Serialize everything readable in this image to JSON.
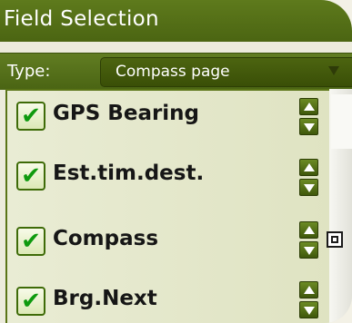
{
  "window": {
    "title": "Field Selection"
  },
  "type": {
    "label": "Type:",
    "selected": "Compass page"
  },
  "fields": [
    {
      "label": "GPS Bearing",
      "checked": true,
      "check_glyph": "✔"
    },
    {
      "label": "Est.tim.dest.",
      "checked": true,
      "check_glyph": "✔"
    },
    {
      "label": "Compass",
      "checked": true,
      "check_glyph": "✔"
    },
    {
      "label": "Brg.Next",
      "checked": true,
      "check_glyph": "✔"
    }
  ],
  "icons": {
    "move_up": "triangle-up-icon",
    "move_down": "triangle-down-icon",
    "field_selected": "square-target-icon"
  },
  "colors": {
    "header_green": "#4f6a14",
    "panel_bg": "#e4e7cb",
    "check_green": "#0e9a0e"
  }
}
